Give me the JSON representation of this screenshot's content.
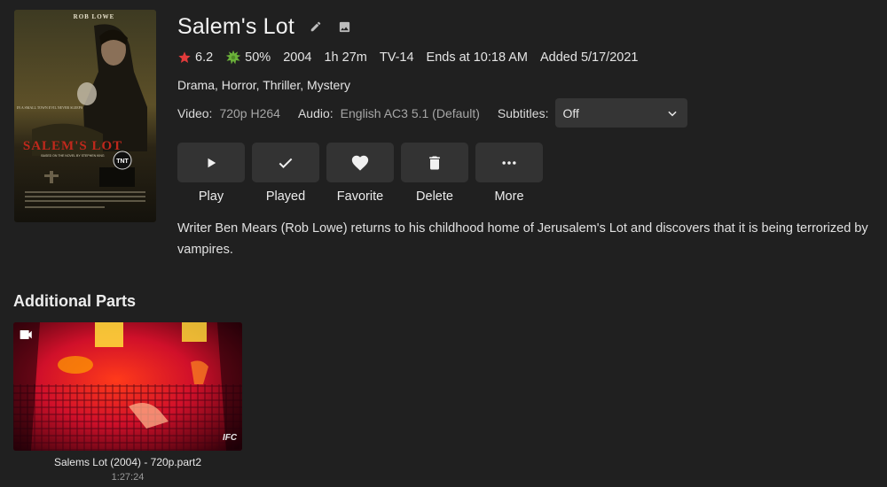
{
  "item": {
    "title": "Salem's Lot",
    "community_rating": "6.2",
    "critic_rating": "50%",
    "year": "2004",
    "runtime": "1h 27m",
    "official_rating": "TV-14",
    "ends_at": "Ends at 10:18 AM",
    "added": "Added 5/17/2021",
    "genres": "Drama, Horror, Thriller, Mystery",
    "overview": "Writer Ben Mears (Rob Lowe) returns to his childhood home of Jerusalem's Lot and discovers that it is being terrorized by vampires."
  },
  "poster": {
    "actor_name": "ROB LOWE",
    "title_text": "SALEM'S LOT",
    "subtitle_text": "BASED ON THE NOVEL BY STEPHEN KING",
    "tagline": "IN A SMALL TOWN EVIL NEVER SLEEPS",
    "network": "TNT"
  },
  "media": {
    "video_label": "Video:",
    "video_value": "720p H264",
    "audio_label": "Audio:",
    "audio_value": "English AC3 5.1 (Default)",
    "subtitles_label": "Subtitles:",
    "subtitles_value": "Off"
  },
  "actions": {
    "play": "Play",
    "played": "Played",
    "favorite": "Favorite",
    "delete": "Delete",
    "more": "More"
  },
  "additional_parts": {
    "heading": "Additional Parts",
    "items": [
      {
        "title": "Salems Lot (2004) - 720p.part2",
        "duration": "1:27:24",
        "watermark": "IFC"
      }
    ]
  },
  "colors": {
    "background": "#202020",
    "button": "#333333",
    "star": "#e23b3b",
    "tomato": "#6bb23a"
  },
  "icons": {
    "edit": "pencil-icon",
    "image": "image-icon",
    "star": "star-icon",
    "critic": "splat-icon",
    "play": "play-icon",
    "played": "check-icon",
    "favorite": "heart-icon",
    "delete": "trash-icon",
    "more": "more-dots-icon",
    "dropdown": "chevron-down-icon",
    "video_badge": "videocam-icon"
  }
}
